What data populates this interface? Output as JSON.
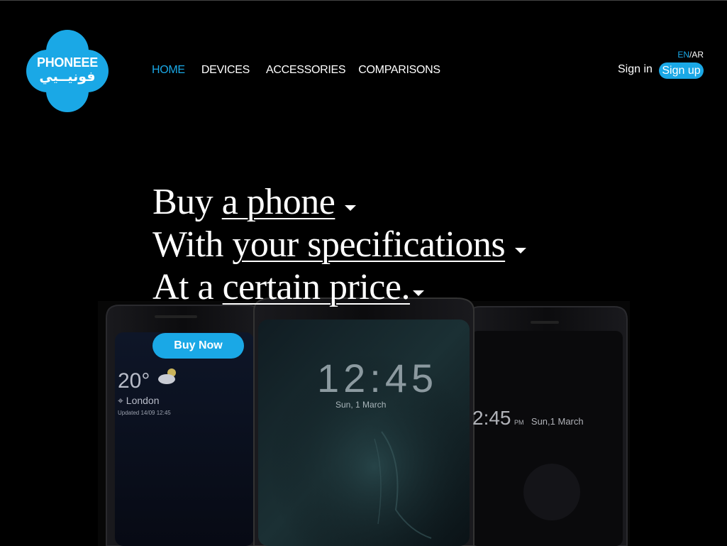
{
  "brand": {
    "name_en": "PHONEEE",
    "name_ar": "فونيــيي",
    "color": "#1aa8e6"
  },
  "nav": {
    "items": [
      {
        "label": "HOME",
        "active": true
      },
      {
        "label": "DEVICES",
        "active": false
      },
      {
        "label": "ACCESSORIES",
        "active": false
      },
      {
        "label": "COMPARISONS",
        "active": false
      }
    ]
  },
  "lang": {
    "en": "EN",
    "separator": "/",
    "ar": "AR"
  },
  "auth": {
    "sign_in": "Sign in",
    "sign_up": "Sign up"
  },
  "hero": {
    "line1": {
      "prefix": "Buy ",
      "choice": "a phone"
    },
    "line2": {
      "prefix": "With ",
      "choice": "your specifications"
    },
    "line3": {
      "prefix": "At a ",
      "choice": "certain price."
    },
    "cta": "Buy Now"
  },
  "phones": {
    "left": {
      "temp": "20°",
      "city": "London",
      "updated": "Updated 14/09 12:45"
    },
    "center": {
      "time": "12:45",
      "date": "Sun, 1 March"
    },
    "right": {
      "time": "2:45",
      "ampm": "PM",
      "date": "Sun,1 March"
    }
  }
}
